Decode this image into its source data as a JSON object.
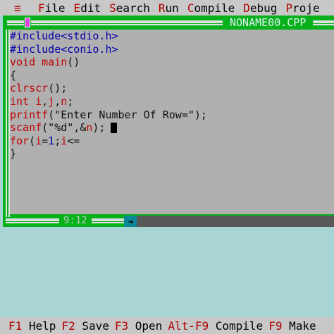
{
  "menu": {
    "system": "≡",
    "items": [
      {
        "hot": "F",
        "rest": "ile"
      },
      {
        "hot": "E",
        "rest": "dit"
      },
      {
        "hot": "S",
        "rest": "earch"
      },
      {
        "hot": "R",
        "rest": "un"
      },
      {
        "hot": "C",
        "rest": "ompile"
      },
      {
        "hot": "D",
        "rest": "ebug"
      },
      {
        "hot": "P",
        "rest": "roje"
      }
    ]
  },
  "window": {
    "title": "NONAME00.CPP",
    "position": "9:12",
    "scroll_arrow": "◄"
  },
  "code": [
    [
      {
        "t": "#include<stdio.h>",
        "c": "#0000a8"
      }
    ],
    [
      {
        "t": "#include<conio.h>",
        "c": "#0000a8"
      }
    ],
    [
      {
        "t": "void",
        "c": "#c00000"
      },
      {
        "t": " ",
        "c": "#101010"
      },
      {
        "t": "main",
        "c": "#c00000"
      },
      {
        "t": "()",
        "c": "#101010"
      }
    ],
    [
      {
        "t": "{",
        "c": "#101010"
      }
    ],
    [
      {
        "t": "clrscr",
        "c": "#c00000"
      },
      {
        "t": "();",
        "c": "#101010"
      }
    ],
    [
      {
        "t": "int",
        "c": "#c00000"
      },
      {
        "t": " ",
        "c": "#101010"
      },
      {
        "t": "i",
        "c": "#c00000"
      },
      {
        "t": ",",
        "c": "#101010"
      },
      {
        "t": "j",
        "c": "#c00000"
      },
      {
        "t": ",",
        "c": "#101010"
      },
      {
        "t": "n",
        "c": "#c00000"
      },
      {
        "t": ";",
        "c": "#101010"
      }
    ],
    [
      {
        "t": "printf",
        "c": "#c00000"
      },
      {
        "t": "(\"Enter Number Of Row=\");",
        "c": "#101010"
      }
    ],
    [
      {
        "t": "scanf",
        "c": "#c00000"
      },
      {
        "t": "(\"%d\",&",
        "c": "#101010"
      },
      {
        "t": "n",
        "c": "#c00000"
      },
      {
        "t": ");",
        "c": "#101010"
      }
    ],
    [
      {
        "t": "for",
        "c": "#c00000"
      },
      {
        "t": "(",
        "c": "#101010"
      },
      {
        "t": "i",
        "c": "#c00000"
      },
      {
        "t": "=",
        "c": "#101010"
      },
      {
        "t": "1",
        "c": "#0000a8"
      },
      {
        "t": ";",
        "c": "#101010"
      },
      {
        "t": "i",
        "c": "#c00000"
      },
      {
        "t": "<=",
        "c": "#101010"
      }
    ],
    [
      {
        "t": "}",
        "c": "#101010"
      }
    ]
  ],
  "status": [
    {
      "key": "F1",
      "label": "Help"
    },
    {
      "key": "F2",
      "label": "Save"
    },
    {
      "key": "F3",
      "label": "Open"
    },
    {
      "key": "Alt-F9",
      "label": "Compile"
    },
    {
      "key": "F9",
      "label": "Make"
    }
  ]
}
